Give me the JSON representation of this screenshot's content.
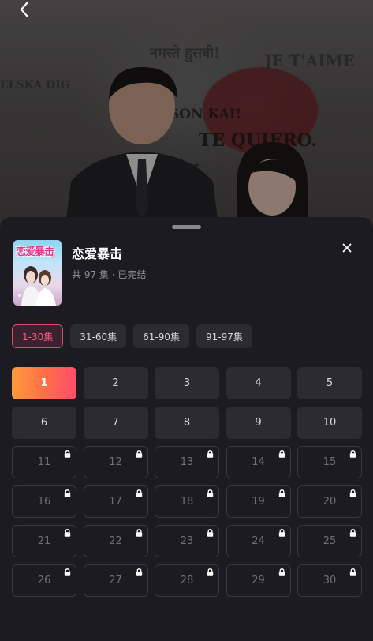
{
  "video_bg": {
    "wall_texts": [
      "नमस्ते हुसबी!",
      "JE T'AIME",
      "ELSKA DIG",
      "SON KAI!",
      "TE QUIERO.",
      "恋爱"
    ]
  },
  "sheet": {
    "title": "恋爱暴击",
    "subtitle": "共 97 集 · 已完结",
    "cover_text": "恋爱暴击",
    "ranges": [
      {
        "label": "1-30集",
        "active": true
      },
      {
        "label": "31-60集",
        "active": false
      },
      {
        "label": "61-90集",
        "active": false
      },
      {
        "label": "91-97集",
        "active": false
      }
    ],
    "episodes": [
      {
        "n": "1",
        "state": "current"
      },
      {
        "n": "2",
        "state": "open"
      },
      {
        "n": "3",
        "state": "open"
      },
      {
        "n": "4",
        "state": "open"
      },
      {
        "n": "5",
        "state": "open"
      },
      {
        "n": "6",
        "state": "open"
      },
      {
        "n": "7",
        "state": "open"
      },
      {
        "n": "8",
        "state": "open"
      },
      {
        "n": "9",
        "state": "open"
      },
      {
        "n": "10",
        "state": "open"
      },
      {
        "n": "11",
        "state": "locked"
      },
      {
        "n": "12",
        "state": "locked"
      },
      {
        "n": "13",
        "state": "locked"
      },
      {
        "n": "14",
        "state": "locked"
      },
      {
        "n": "15",
        "state": "locked"
      },
      {
        "n": "16",
        "state": "locked"
      },
      {
        "n": "17",
        "state": "locked"
      },
      {
        "n": "18",
        "state": "locked"
      },
      {
        "n": "19",
        "state": "locked"
      },
      {
        "n": "20",
        "state": "locked"
      },
      {
        "n": "21",
        "state": "locked"
      },
      {
        "n": "22",
        "state": "locked"
      },
      {
        "n": "23",
        "state": "locked"
      },
      {
        "n": "24",
        "state": "locked"
      },
      {
        "n": "25",
        "state": "locked"
      },
      {
        "n": "26",
        "state": "locked"
      },
      {
        "n": "27",
        "state": "locked"
      },
      {
        "n": "28",
        "state": "locked"
      },
      {
        "n": "29",
        "state": "locked"
      },
      {
        "n": "30",
        "state": "locked"
      }
    ]
  },
  "icons": {
    "back": "chevron-left-icon",
    "close": "close-icon",
    "lock": "lock-icon"
  },
  "colors": {
    "accent_active_border": "#e04868",
    "accent_active_text": "#ff5c7c",
    "current_gradient_start": "#ff9b3a",
    "current_gradient_end": "#ff4d6a",
    "sheet_bg": "#1c1b21"
  }
}
